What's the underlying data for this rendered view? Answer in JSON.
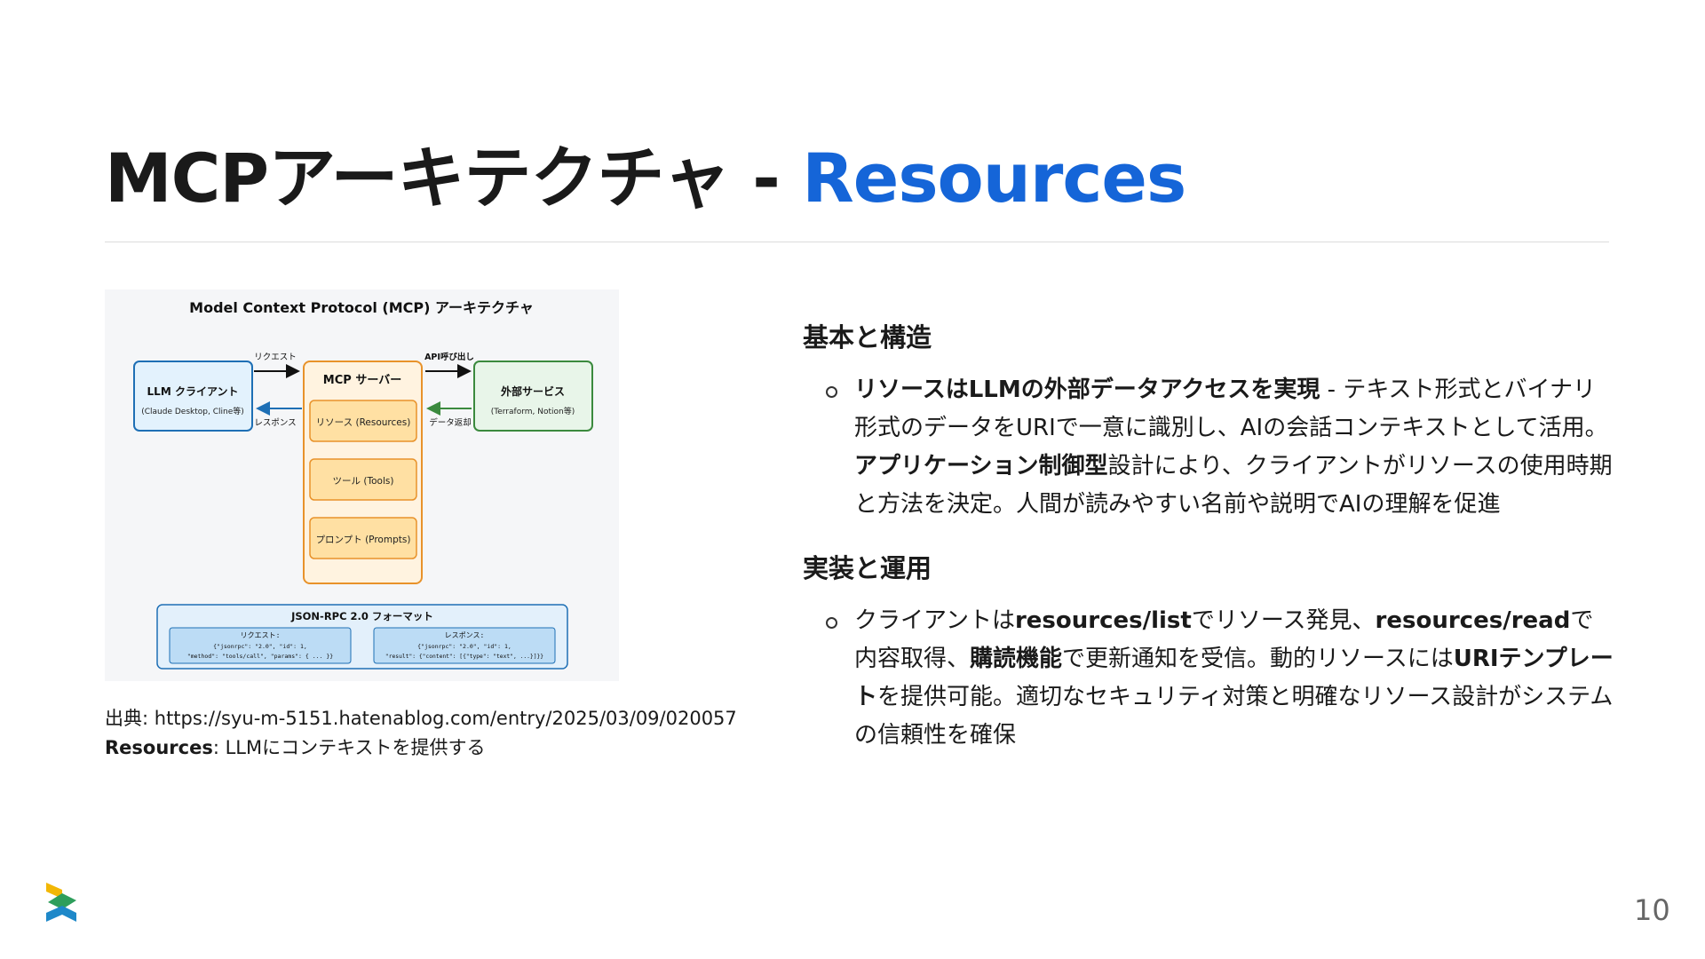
{
  "slide": {
    "title_main": "MCPアーキテクチャ - ",
    "title_accent": "Resources",
    "page_number": "10"
  },
  "diagram": {
    "title": "Model Context Protocol (MCP) アーキテクチャ",
    "llm_client": {
      "title": "LLM クライアント",
      "subtitle": "(Claude Desktop, Cline等)"
    },
    "mcp_server": {
      "title": "MCP サーバー",
      "items": [
        "リソース (Resources)",
        "ツール (Tools)",
        "プロンプト (Prompts)"
      ]
    },
    "external": {
      "title": "外部サービス",
      "subtitle": "(Terraform, Notion等)"
    },
    "arrows": {
      "request": "リクエスト",
      "response": "レスポンス",
      "api_call": "API呼び出し",
      "data_return": "データ返却"
    },
    "jsonrpc": {
      "title": "JSON-RPC 2.0 フォーマット",
      "request_label": "リクエスト:",
      "request_line1": "{\"jsonrpc\": \"2.0\", \"id\": 1,",
      "request_line2": "\"method\": \"tools/call\", \"params\": { ... }}",
      "response_label": "レスポンス:",
      "response_line1": "{\"jsonrpc\": \"2.0\", \"id\": 1,",
      "response_line2": "\"result\": {\"content\": [{\"type\": \"text\", ...}]}}"
    },
    "colors": {
      "client_fill": "#e3f2fd",
      "client_stroke": "#1e6fb5",
      "server_fill": "#fff3e0",
      "server_stroke": "#e8922a",
      "item_fill": "#ffe0a3",
      "external_fill": "#e8f5e9",
      "external_stroke": "#3b8a3e",
      "jsonrpc_fill": "#e3f0fb",
      "jsonrpc_inner": "#bcdcf5"
    }
  },
  "caption": {
    "source_label": "出典: ",
    "source_url": "https://syu-m-5151.hatenablog.com/entry/2025/03/09/020057",
    "resources_label": "Resources",
    "resources_text": ": LLMにコンテキストを提供する"
  },
  "sections": [
    {
      "heading": "基本と構造",
      "bullet": {
        "b1": "リソースはLLMの外部データアクセスを実現",
        "t1": " - テキスト形式とバイナリ形式のデータをURIで一意に識別し、AIの会話コンテキストとして活用。",
        "b2": "アプリケーション制御型",
        "t2": "設計により、クライアントがリソースの使用時期と方法を決定。人間が読みやすい名前や説明でAIの理解を促進"
      }
    },
    {
      "heading": "実装と運用",
      "bullet": {
        "t1": "クライアントは",
        "b1": "resources/list",
        "t2": "でリソース発見、",
        "b2": "resources/read",
        "t3": "で内容取得、",
        "b3": "購読機能",
        "t4": "で更新通知を受信。動的リソースには",
        "b4": "URIテンプレート",
        "t5": "を提供可能。適切なセキュリティ対策と明確なリソース設計がシステムの信頼性を確保"
      }
    }
  ],
  "logo": {
    "colors": [
      "#f2b705",
      "#2e9e5b",
      "#1e88c9"
    ]
  }
}
